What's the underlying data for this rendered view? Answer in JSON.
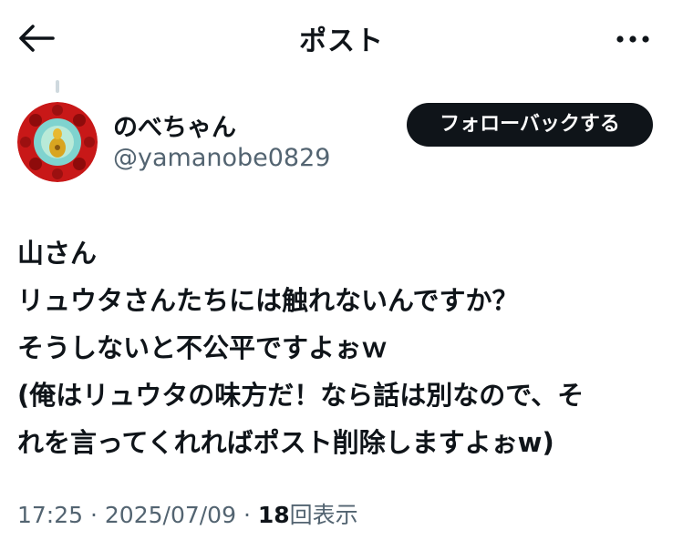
{
  "header": {
    "title": "ポスト",
    "back_icon": "back-arrow-icon",
    "more_icon": "more-options-icon"
  },
  "author": {
    "display_name": "のべちゃん",
    "handle": "@yamanobe0829",
    "follow_button_label": "フォローバックする"
  },
  "post": {
    "lines": [
      "山さん",
      "リュウタさんたちには触れないんですか？",
      "そうしないと不公平ですよぉｗ",
      "(俺はリュウタの味方だ！なら話は別なので、そ",
      "れを言ってくれればポスト削除しますよぉw)"
    ]
  },
  "meta": {
    "time": "17:25",
    "separator": "·",
    "date": "2025/07/09",
    "views_count": "18",
    "views_label": "回表示"
  },
  "colors": {
    "text": "#0f1419",
    "secondary": "#536471",
    "button_bg": "#0f1419",
    "button_text": "#ffffff",
    "avatar_ring": "#c81818"
  }
}
